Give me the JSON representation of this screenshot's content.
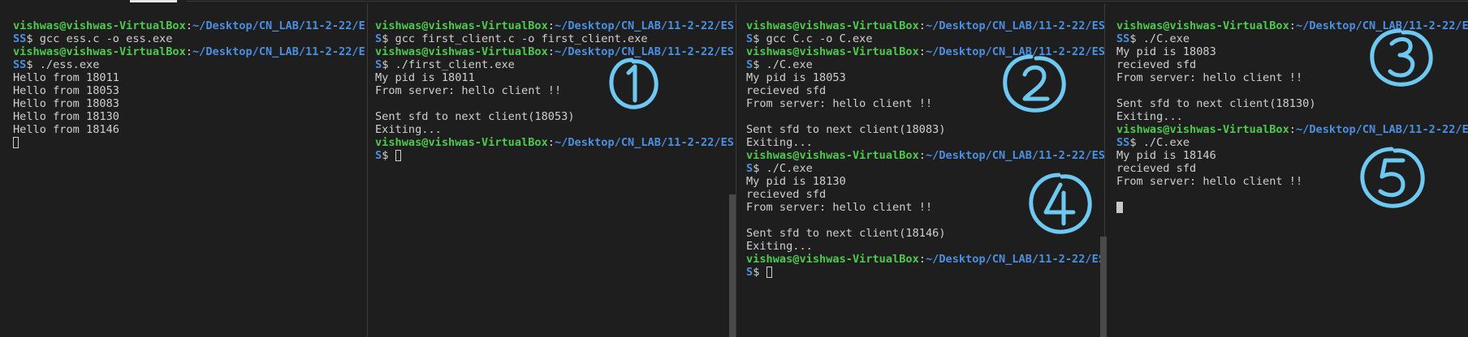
{
  "prompt": {
    "user_host": "vishwas@vishwas-VirtualBox",
    "sep": ":",
    "path": "~/Desktop/CN_LAB/11-2-22/ESS",
    "dollar": "$"
  },
  "panes": [
    {
      "lines": [
        {
          "t": "prompt1",
          "user": "vishwas@vishwas-VirtualBox",
          "sep": ":",
          "path": "~/Desktop/CN_LAB/11-2-22/E"
        },
        {
          "t": "prompt2",
          "path": "SS",
          "cmd": "$ gcc ess.c -o ess.exe"
        },
        {
          "t": "prompt1",
          "user": "vishwas@vishwas-VirtualBox",
          "sep": ":",
          "path": "~/Desktop/CN_LAB/11-2-22/E"
        },
        {
          "t": "prompt2",
          "path": "SS",
          "cmd": "$ ./ess.exe"
        },
        {
          "t": "out",
          "text": "Hello from 18011"
        },
        {
          "t": "out",
          "text": "Hello from 18053"
        },
        {
          "t": "out",
          "text": "Hello from 18083"
        },
        {
          "t": "out",
          "text": "Hello from 18130"
        },
        {
          "t": "out",
          "text": "Hello from 18146"
        },
        {
          "t": "cursor-box"
        }
      ]
    },
    {
      "lines": [
        {
          "t": "prompt1",
          "user": "vishwas@vishwas-VirtualBox",
          "sep": ":",
          "path": "~/Desktop/CN_LAB/11-2-22/ES"
        },
        {
          "t": "prompt2",
          "path": "S",
          "cmd": "$ gcc first_client.c -o first_client.exe"
        },
        {
          "t": "prompt1",
          "user": "vishwas@vishwas-VirtualBox",
          "sep": ":",
          "path": "~/Desktop/CN_LAB/11-2-22/ES"
        },
        {
          "t": "prompt2",
          "path": "S",
          "cmd": "$ ./first_client.exe"
        },
        {
          "t": "out",
          "text": "My pid is 18011"
        },
        {
          "t": "out",
          "text": "From server: hello client !!"
        },
        {
          "t": "out",
          "text": ""
        },
        {
          "t": "out",
          "text": "Sent sfd to next client(18053)"
        },
        {
          "t": "out",
          "text": "Exiting..."
        },
        {
          "t": "prompt1",
          "user": "vishwas@vishwas-VirtualBox",
          "sep": ":",
          "path": "~/Desktop/CN_LAB/11-2-22/ES"
        },
        {
          "t": "prompt2-cursor",
          "path": "S",
          "cmd": "$ "
        }
      ]
    },
    {
      "lines": [
        {
          "t": "prompt1",
          "user": "vishwas@vishwas-VirtualBox",
          "sep": ":",
          "path": "~/Desktop/CN_LAB/11-2-22/ES"
        },
        {
          "t": "prompt2",
          "path": "S",
          "cmd": "$ gcc C.c -o C.exe"
        },
        {
          "t": "prompt1",
          "user": "vishwas@vishwas-VirtualBox",
          "sep": ":",
          "path": "~/Desktop/CN_LAB/11-2-22/ES"
        },
        {
          "t": "prompt2",
          "path": "S",
          "cmd": "$ ./C.exe"
        },
        {
          "t": "out",
          "text": "My pid is 18053"
        },
        {
          "t": "out",
          "text": "recieved sfd"
        },
        {
          "t": "out",
          "text": "From server: hello client !!"
        },
        {
          "t": "out",
          "text": ""
        },
        {
          "t": "out",
          "text": "Sent sfd to next client(18083)"
        },
        {
          "t": "out",
          "text": "Exiting..."
        },
        {
          "t": "prompt1",
          "user": "vishwas@vishwas-VirtualBox",
          "sep": ":",
          "path": "~/Desktop/CN_LAB/11-2-22/ES"
        },
        {
          "t": "prompt2",
          "path": "S",
          "cmd": "$ ./C.exe"
        },
        {
          "t": "out",
          "text": "My pid is 18130"
        },
        {
          "t": "out",
          "text": "recieved sfd"
        },
        {
          "t": "out",
          "text": "From server: hello client !!"
        },
        {
          "t": "out",
          "text": ""
        },
        {
          "t": "out",
          "text": "Sent sfd to next client(18146)"
        },
        {
          "t": "out",
          "text": "Exiting..."
        },
        {
          "t": "prompt1",
          "user": "vishwas@vishwas-VirtualBox",
          "sep": ":",
          "path": "~/Desktop/CN_LAB/11-2-22/ES"
        },
        {
          "t": "prompt2-cursor",
          "path": "S",
          "cmd": "$ "
        }
      ]
    },
    {
      "lines": [
        {
          "t": "prompt1",
          "user": "vishwas@vishwas-VirtualBox",
          "sep": ":",
          "path": "~/Desktop/CN_LAB/11-2-22/E"
        },
        {
          "t": "prompt2",
          "path": "SS",
          "cmd": "$ ./C.exe"
        },
        {
          "t": "out",
          "text": "My pid is 18083"
        },
        {
          "t": "out",
          "text": "recieved sfd"
        },
        {
          "t": "out",
          "text": "From server: hello client !!"
        },
        {
          "t": "out",
          "text": ""
        },
        {
          "t": "out",
          "text": "Sent sfd to next client(18130)"
        },
        {
          "t": "out",
          "text": "Exiting..."
        },
        {
          "t": "prompt1",
          "user": "vishwas@vishwas-VirtualBox",
          "sep": ":",
          "path": "~/Desktop/CN_LAB/11-2-22/E"
        },
        {
          "t": "prompt2",
          "path": "SS",
          "cmd": "$ ./C.exe"
        },
        {
          "t": "out",
          "text": "My pid is 18146"
        },
        {
          "t": "out",
          "text": "recieved sfd"
        },
        {
          "t": "out",
          "text": "From server: hello client !!"
        },
        {
          "t": "out",
          "text": ""
        },
        {
          "t": "cursor-block"
        }
      ]
    }
  ],
  "annotations": [
    {
      "label": "1",
      "color": "#6ec9f2"
    },
    {
      "label": "2",
      "color": "#6ec9f2"
    },
    {
      "label": "3",
      "color": "#6ec9f2"
    },
    {
      "label": "4",
      "color": "#6ec9f2"
    },
    {
      "label": "5",
      "color": "#6ec9f2"
    }
  ],
  "colors": {
    "background": "#1e1e1e",
    "user_host": "#4ec94e",
    "path": "#4a8fe0",
    "text": "#d0d0d0",
    "annotation": "#6ec9f2"
  }
}
